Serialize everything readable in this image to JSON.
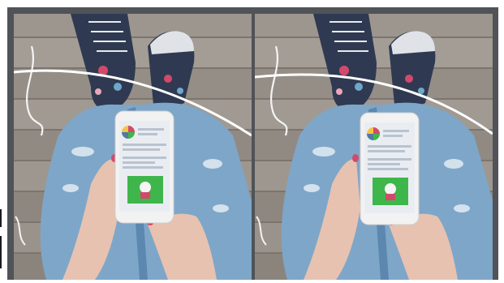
{
  "image": {
    "description_panels": 2,
    "colors": {
      "background": "#ffffff",
      "frame": "#505357",
      "wood_light": "#a39c94",
      "wood_dark": "#6f6861",
      "denim": "#7ea6c8",
      "denim_dark": "#4f7aa4",
      "skin": "#e7c2b0",
      "nail": "#d24a6b",
      "phone_body": "#f2f2f2",
      "phone_screen": "#e9edf2",
      "screen_green": "#3fb64b",
      "shoe_pattern": "#2f3a52",
      "curve_line": "#ffffff"
    },
    "icons": {
      "left_panel_app_icon": "app-logo-icon",
      "right_panel_app_icon": "app-logo-icon"
    }
  }
}
